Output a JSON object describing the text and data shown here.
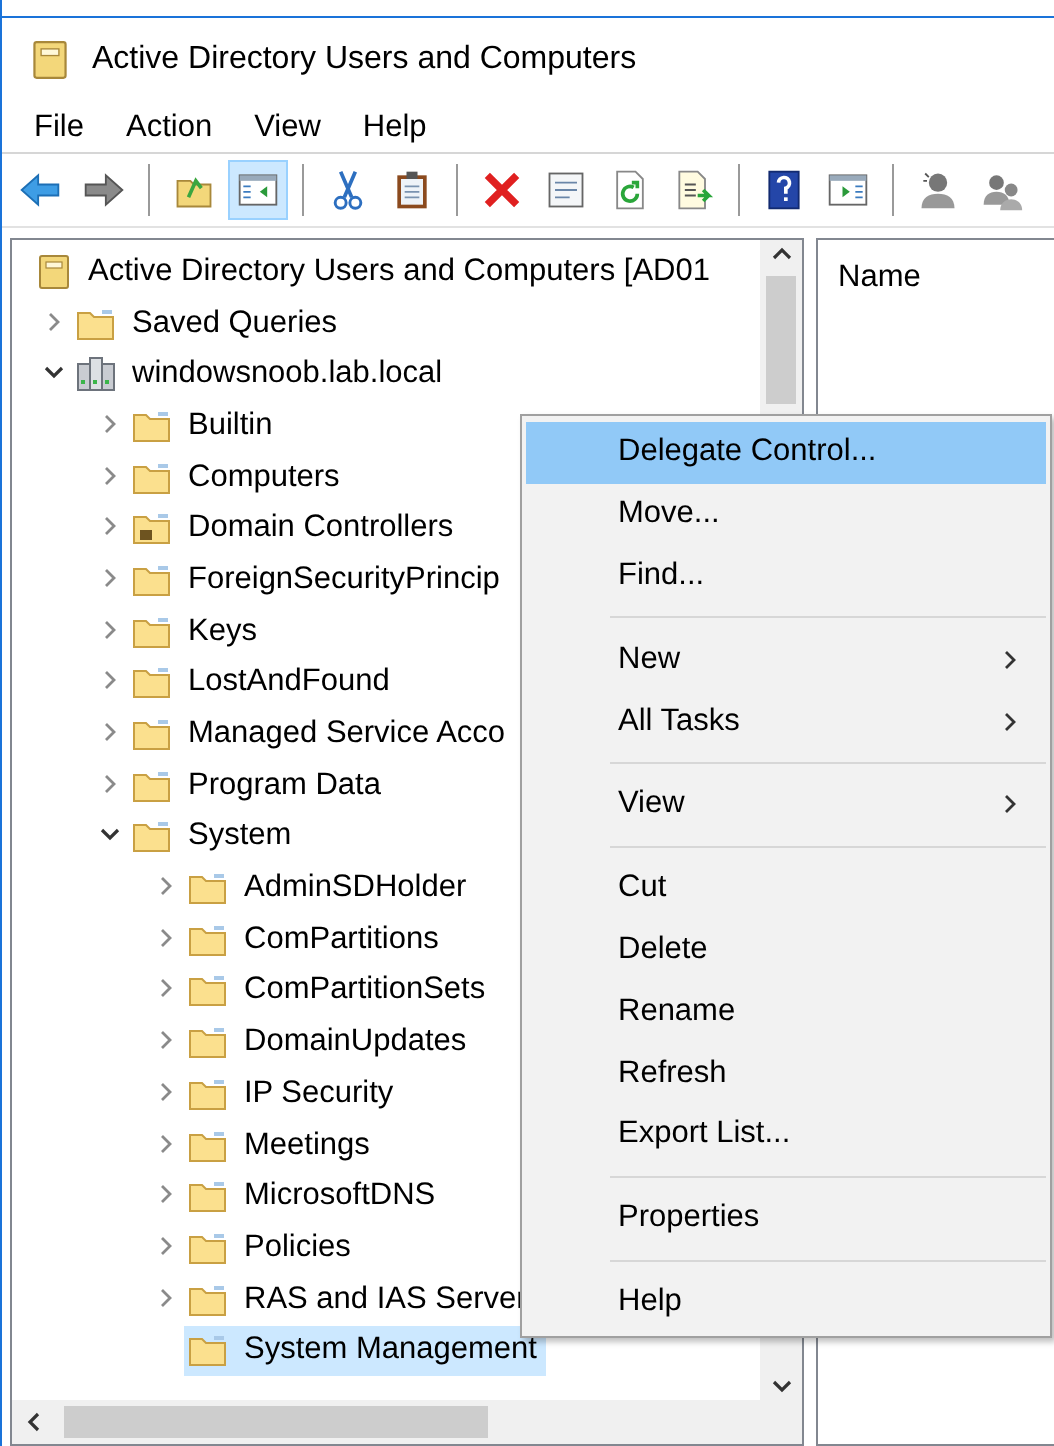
{
  "window": {
    "title": "Active Directory Users and Computers"
  },
  "menu_bar": [
    {
      "label": "File"
    },
    {
      "label": "Action"
    },
    {
      "label": "View"
    },
    {
      "label": "Help"
    }
  ],
  "toolbar": [
    {
      "kind": "back",
      "pressed": false
    },
    {
      "kind": "forward",
      "pressed": false
    },
    {
      "kind": "separator"
    },
    {
      "kind": "up",
      "pressed": false
    },
    {
      "kind": "tree-toggle",
      "pressed": true
    },
    {
      "kind": "separator"
    },
    {
      "kind": "cut",
      "pressed": false
    },
    {
      "kind": "paste",
      "pressed": false
    },
    {
      "kind": "separator"
    },
    {
      "kind": "delete",
      "pressed": false
    },
    {
      "kind": "properties",
      "pressed": false
    },
    {
      "kind": "refresh",
      "pressed": false
    },
    {
      "kind": "export",
      "pressed": false
    },
    {
      "kind": "separator"
    },
    {
      "kind": "help",
      "pressed": false
    },
    {
      "kind": "action-pane",
      "pressed": false
    },
    {
      "kind": "separator"
    },
    {
      "kind": "user",
      "pressed": false
    },
    {
      "kind": "users",
      "pressed": false
    }
  ],
  "tree": [
    {
      "label": "Active Directory Users and Computers [AD01",
      "kind": "console",
      "expandable": false,
      "selected": false,
      "children": [
        {
          "label": "Saved Queries",
          "kind": "folder",
          "expandable": true,
          "expanded": false,
          "selected": false
        },
        {
          "label": "windowsnoob.lab.local",
          "kind": "domain",
          "expandable": true,
          "expanded": true,
          "selected": false,
          "children": [
            {
              "label": "Builtin",
              "kind": "folder",
              "expandable": true,
              "expanded": false,
              "selected": false
            },
            {
              "label": "Computers",
              "kind": "folder",
              "expandable": true,
              "expanded": false,
              "selected": false
            },
            {
              "label": "Domain Controllers",
              "kind": "ou",
              "expandable": true,
              "expanded": false,
              "selected": false
            },
            {
              "label": "ForeignSecurityPrincip",
              "kind": "folder",
              "expandable": true,
              "expanded": false,
              "selected": false
            },
            {
              "label": "Keys",
              "kind": "folder",
              "expandable": true,
              "expanded": false,
              "selected": false
            },
            {
              "label": "LostAndFound",
              "kind": "folder",
              "expandable": true,
              "expanded": false,
              "selected": false
            },
            {
              "label": "Managed Service Acco",
              "kind": "folder",
              "expandable": true,
              "expanded": false,
              "selected": false
            },
            {
              "label": "Program Data",
              "kind": "folder",
              "expandable": true,
              "expanded": false,
              "selected": false
            },
            {
              "label": "System",
              "kind": "folder",
              "expandable": true,
              "expanded": true,
              "selected": false,
              "children": [
                {
                  "label": "AdminSDHolder",
                  "kind": "folder",
                  "expandable": true,
                  "expanded": false,
                  "selected": false
                },
                {
                  "label": "ComPartitions",
                  "kind": "folder",
                  "expandable": true,
                  "expanded": false,
                  "selected": false
                },
                {
                  "label": "ComPartitionSets",
                  "kind": "folder",
                  "expandable": true,
                  "expanded": false,
                  "selected": false
                },
                {
                  "label": "DomainUpdates",
                  "kind": "folder",
                  "expandable": true,
                  "expanded": false,
                  "selected": false
                },
                {
                  "label": "IP Security",
                  "kind": "folder",
                  "expandable": true,
                  "expanded": false,
                  "selected": false
                },
                {
                  "label": "Meetings",
                  "kind": "folder",
                  "expandable": true,
                  "expanded": false,
                  "selected": false
                },
                {
                  "label": "MicrosoftDNS",
                  "kind": "folder",
                  "expandable": true,
                  "expanded": false,
                  "selected": false
                },
                {
                  "label": "Policies",
                  "kind": "folder",
                  "expandable": true,
                  "expanded": false,
                  "selected": false
                },
                {
                  "label": "RAS and IAS Server",
                  "kind": "folder",
                  "expandable": true,
                  "expanded": false,
                  "selected": false
                },
                {
                  "label": "System Management",
                  "kind": "folder",
                  "expandable": false,
                  "selected": true
                }
              ]
            }
          ]
        }
      ]
    }
  ],
  "list_pane": {
    "columns": [
      "Name"
    ]
  },
  "context_menu": [
    {
      "kind": "item",
      "label": "Delegate Control...",
      "selected": true,
      "submenu": false
    },
    {
      "kind": "item",
      "label": "Move...",
      "selected": false,
      "submenu": false
    },
    {
      "kind": "item",
      "label": "Find...",
      "selected": false,
      "submenu": false
    },
    {
      "kind": "separator"
    },
    {
      "kind": "item",
      "label": "New",
      "selected": false,
      "submenu": true
    },
    {
      "kind": "item",
      "label": "All Tasks",
      "selected": false,
      "submenu": true
    },
    {
      "kind": "separator"
    },
    {
      "kind": "item",
      "label": "View",
      "selected": false,
      "submenu": true
    },
    {
      "kind": "separator"
    },
    {
      "kind": "item",
      "label": "Cut",
      "selected": false,
      "submenu": false
    },
    {
      "kind": "item",
      "label": "Delete",
      "selected": false,
      "submenu": false
    },
    {
      "kind": "item",
      "label": "Rename",
      "selected": false,
      "submenu": false
    },
    {
      "kind": "item",
      "label": "Refresh",
      "selected": false,
      "submenu": false
    },
    {
      "kind": "item",
      "label": "Export List...",
      "selected": false,
      "submenu": false
    },
    {
      "kind": "separator"
    },
    {
      "kind": "item",
      "label": "Properties",
      "selected": false,
      "submenu": false
    },
    {
      "kind": "separator"
    },
    {
      "kind": "item",
      "label": "Help",
      "selected": false,
      "submenu": false
    }
  ]
}
